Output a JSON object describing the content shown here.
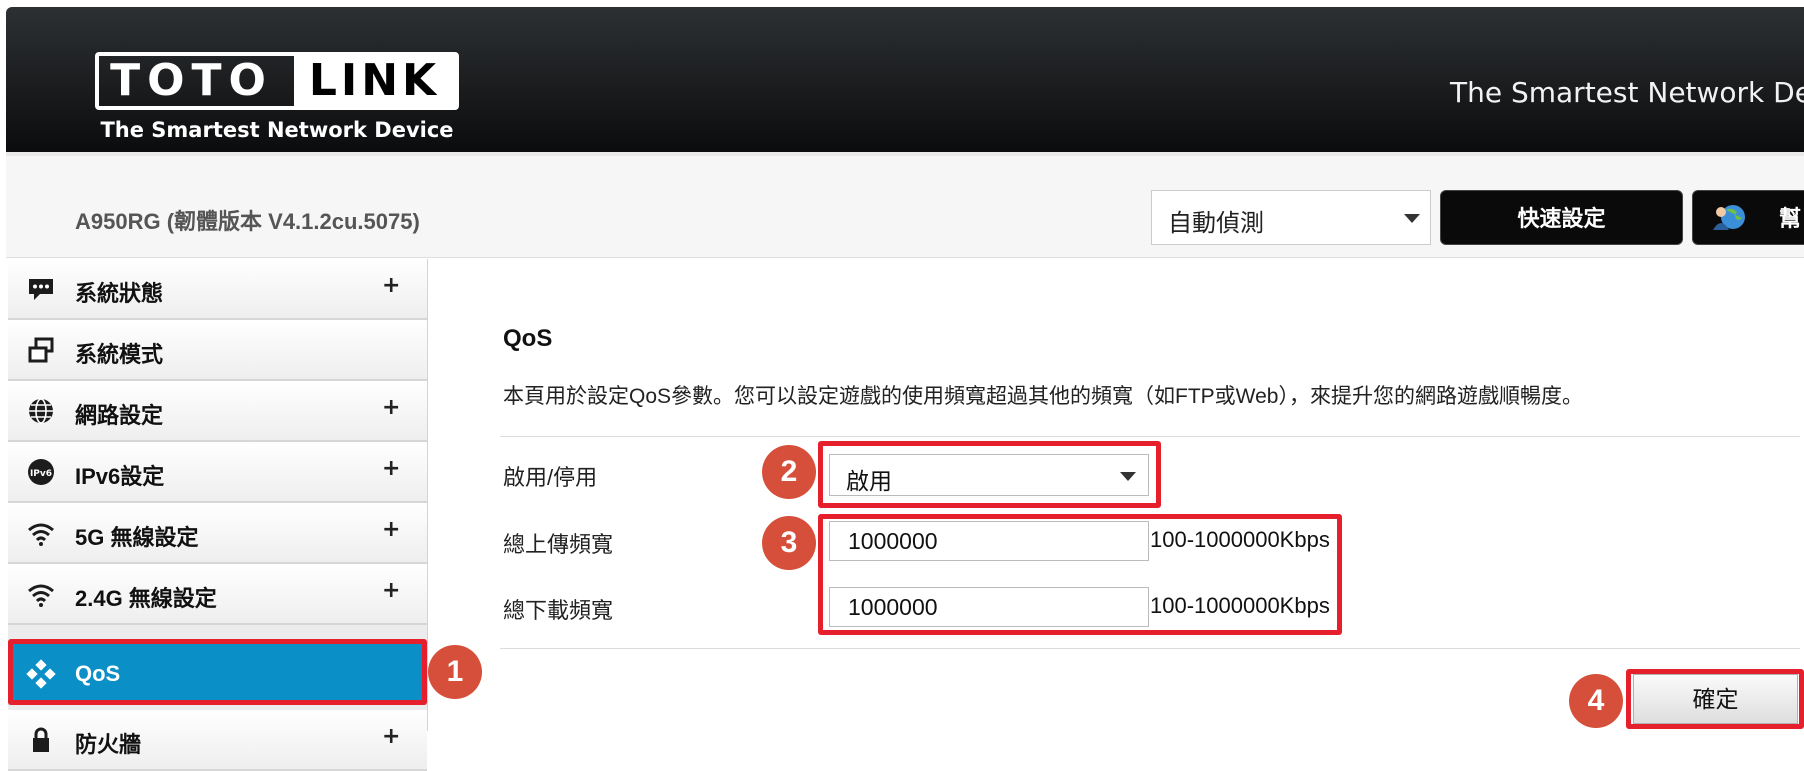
{
  "header": {
    "logo_left": "TOTO",
    "logo_right": "LINK",
    "logo_tagline": "The Smartest Network Device",
    "slogan": "The Smartest Network Devic"
  },
  "topbar": {
    "model": "A950RG (韌體版本 V4.1.2cu.5075)",
    "language_select": {
      "value": "自動偵測"
    },
    "quick_setup_label": "快速設定",
    "help_label": "幫"
  },
  "sidebar": {
    "items": [
      {
        "label": "系統狀態",
        "icon": "chat-bubble-icon",
        "expand": "+"
      },
      {
        "label": "系統模式",
        "icon": "window-icon",
        "expand": ""
      },
      {
        "label": "網路設定",
        "icon": "globe-icon",
        "expand": "+"
      },
      {
        "label": "IPv6設定",
        "icon": "ipv6-icon",
        "expand": "+"
      },
      {
        "label": "5G 無線設定",
        "icon": "wifi-icon",
        "expand": "+"
      },
      {
        "label": "2.4G 無線設定",
        "icon": "wifi-icon",
        "expand": "+"
      },
      {
        "label": "QoS",
        "icon": "qos-icon",
        "expand": ""
      },
      {
        "label": "防火牆",
        "icon": "lock-icon",
        "expand": "+"
      }
    ],
    "active_index": 6
  },
  "content": {
    "title": "QoS",
    "description": "本頁用於設定QoS參數。您可以設定遊戲的使用頻寬超過其他的頻寬（如FTP或Web），來提升您的網路遊戲順暢度。",
    "enable_label": "啟用/停用",
    "enable_value": "啟用",
    "upload_label": "總上傳頻寬",
    "upload_value": "1000000",
    "upload_unit": "100-1000000Kbps",
    "download_label": "總下載頻寬",
    "download_value": "1000000",
    "download_unit": "100-1000000Kbps",
    "ok_label": "確定"
  },
  "annotations": {
    "step1": "1",
    "step2": "2",
    "step3": "3",
    "step4": "4"
  },
  "colors": {
    "accent_blue": "#0a8fc6",
    "highlight_red": "#e51f2b",
    "badge": "#d64f3a"
  }
}
